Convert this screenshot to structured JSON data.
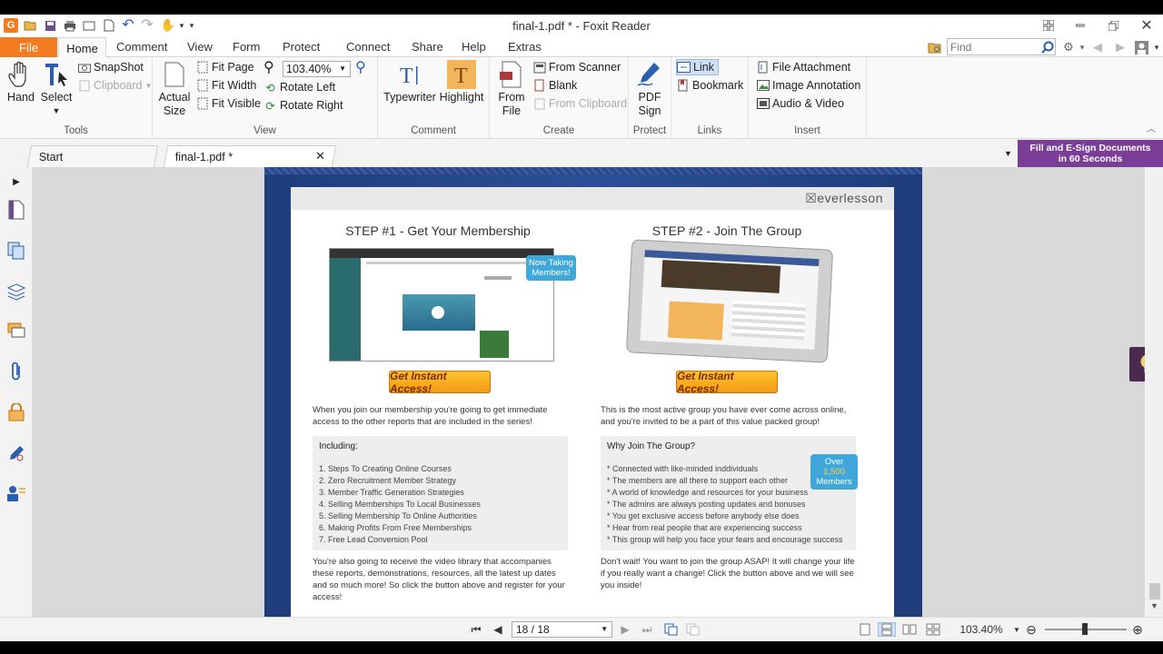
{
  "window": {
    "title": "final-1.pdf * - Foxit Reader"
  },
  "ribbon_tabs": [
    "File",
    "Home",
    "Comment",
    "View",
    "Form",
    "Protect",
    "Connect",
    "Share",
    "Help",
    "Extras"
  ],
  "find": {
    "placeholder": "Find"
  },
  "tools": {
    "hand": "Hand",
    "select": "Select",
    "snapshot": "SnapShot",
    "clipboard": "Clipboard",
    "label": "Tools"
  },
  "view": {
    "actual_size_1": "Actual",
    "actual_size_2": "Size",
    "fit_page": "Fit Page",
    "fit_width": "Fit Width",
    "fit_visible": "Fit Visible",
    "zoom": "103.40%",
    "rotate_left": "Rotate Left",
    "rotate_right": "Rotate Right",
    "label": "View"
  },
  "comment": {
    "typewriter": "Typewriter",
    "highlight": "Highlight",
    "label": "Comment"
  },
  "create": {
    "from_file_1": "From",
    "from_file_2": "File",
    "from_scanner": "From Scanner",
    "blank": "Blank",
    "from_clipboard": "From Clipboard",
    "label": "Create"
  },
  "protect": {
    "pdf": "PDF",
    "sign": "Sign",
    "label": "Protect"
  },
  "links": {
    "link": "Link",
    "bookmark": "Bookmark",
    "label": "Links"
  },
  "insert": {
    "file_attachment": "File Attachment",
    "image_annotation": "Image Annotation",
    "audio_video": "Audio & Video",
    "label": "Insert"
  },
  "doc_tabs": {
    "start": "Start",
    "current": "final-1.pdf *"
  },
  "promo": {
    "line1": "Fill and E-Sign Documents",
    "line2": "in 60 Seconds"
  },
  "page_content": {
    "logo": "everlesson",
    "step1": {
      "title": "STEP #1 - Get Your Membership",
      "bubble": "Now Taking Members!",
      "cta": "Get Instant Access!",
      "intro": "When you join our membership you're going to get immediate access to the other reports that are included in the series!",
      "box_title": "Including:",
      "items": [
        "1. Steps To Creating Online Courses",
        "2. Zero Recruitment Member Strategy",
        "3. Member Traffic Generation Strategies",
        "4. Selling Memberships To Local Businesses",
        "5. Selling Membership To Online Authorities",
        "6. Making Profits From Free Memberships",
        "7. Free Lead Conversion Pool"
      ],
      "outro": "You're also going to receive the video library that accompanies these reports, demonstrations, resources, all the latest up dates and so much more!  So click the button above and register for your access!"
    },
    "step2": {
      "title": "STEP #2 - Join The Group",
      "cta": "Get Instant Access!",
      "intro": "This is the most active group you have ever come across online, and you're invited to be a part of this value packed group!",
      "box_title": "Why Join The Group?",
      "bubble_a": "Over",
      "bubble_b": "1,500",
      "bubble_c": "Members",
      "items": [
        "* Connected with like-minded inddividuals",
        "* The members are all there to support each other",
        "* A world of knowledge and resources for your business",
        "* The admins are always posting updates and bonuses",
        "* You get exclusive access before anybody else does",
        "* Hear from real people that are experiencing success",
        "* This group will help you face your fears and encourage success"
      ],
      "outro": "Don't wait!  You want to join the group ASAP!  It will change your life if you really want a change!  Click the button above and we will see you inside!"
    }
  },
  "status": {
    "page": "18 / 18",
    "zoom": "103.40%"
  },
  "colors": {
    "accent": "#f47b20",
    "promo": "#7a3e96",
    "page_bg": "#2c4f97",
    "cta": "#f39a11",
    "bubble": "#3fa7d9"
  }
}
